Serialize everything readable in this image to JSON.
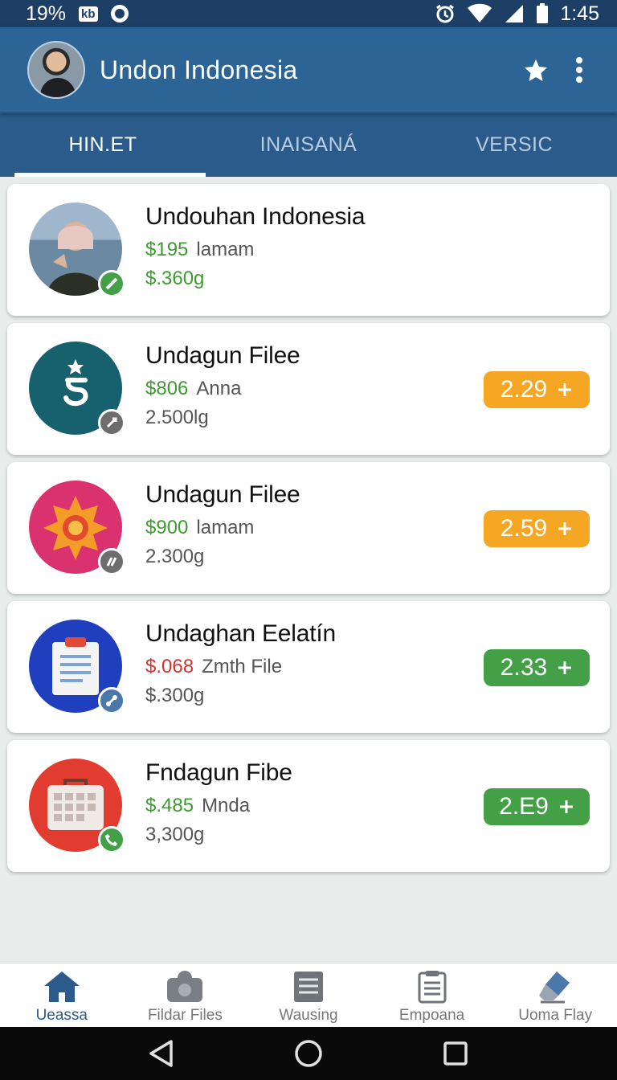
{
  "status_bar": {
    "battery_percent": "19%",
    "badge": "kb",
    "time": "1:45"
  },
  "app_bar": {
    "title": "Undon Indonesia"
  },
  "tabs": [
    {
      "label": "HIN.ET",
      "active": true
    },
    {
      "label": "INAISANÁ",
      "active": false
    },
    {
      "label": "VERSIC",
      "active": false
    }
  ],
  "items": [
    {
      "title": "Undouhan Indonesia",
      "price": "$195",
      "price_color": "#3c9a2f",
      "price_suffix": "lamam",
      "line2": "$.360g",
      "line2_color": "#3c9a2f",
      "button_label": "",
      "icon": "person-photo-icon",
      "badge_icon": "check-icon"
    },
    {
      "title": "Undagun Filee",
      "price": "$806",
      "price_color": "#3c9a2f",
      "price_suffix": "Anna",
      "line2": "2.500lg",
      "button_label": "2.29",
      "button_color": "#f5a623",
      "icon": "star-s-logo-icon",
      "badge_icon": "link-icon"
    },
    {
      "title": "Undagun Filee",
      "price": "$900",
      "price_color": "#3c9a2f",
      "price_suffix": "lamam",
      "line2": "2.300g",
      "button_label": "2.59",
      "button_color": "#f5a623",
      "icon": "sun-emblem-icon",
      "badge_icon": "link-icon"
    },
    {
      "title": "Undaghan Eelatín",
      "price": "$.068",
      "price_color": "#d6312b",
      "price_suffix": "Zmth File",
      "line2": "$.300g",
      "button_label": "2.33",
      "button_color": "#43a047",
      "icon": "clipboard-icon",
      "badge_icon": "link-icon"
    },
    {
      "title": "Fndagun Fibe",
      "price": "$.485",
      "price_color": "#3c9a2f",
      "price_suffix": "Mnda",
      "line2": "3,300g",
      "button_label": "2.E9",
      "button_color": "#43a047",
      "icon": "calendar-basket-icon",
      "badge_icon": "phone-icon"
    }
  ],
  "bottom_nav": [
    {
      "label": "Ueassa",
      "icon": "home-icon",
      "active": true
    },
    {
      "label": "Fildar Files",
      "icon": "camera-icon",
      "active": false
    },
    {
      "label": "Wausing",
      "icon": "document-icon",
      "active": false
    },
    {
      "label": "Empoana",
      "icon": "clipboard-list-icon",
      "active": false
    },
    {
      "label": "Uoma Flay",
      "icon": "eraser-icon",
      "active": false
    }
  ],
  "colors": {
    "status_bar": "#1d3f66",
    "app_bar": "#2d6496",
    "tabs_bar": "#2a5b8a",
    "green_price": "#3c9a2f",
    "red_price": "#d6312b",
    "orange_button": "#f5a623",
    "green_button": "#43a047"
  }
}
